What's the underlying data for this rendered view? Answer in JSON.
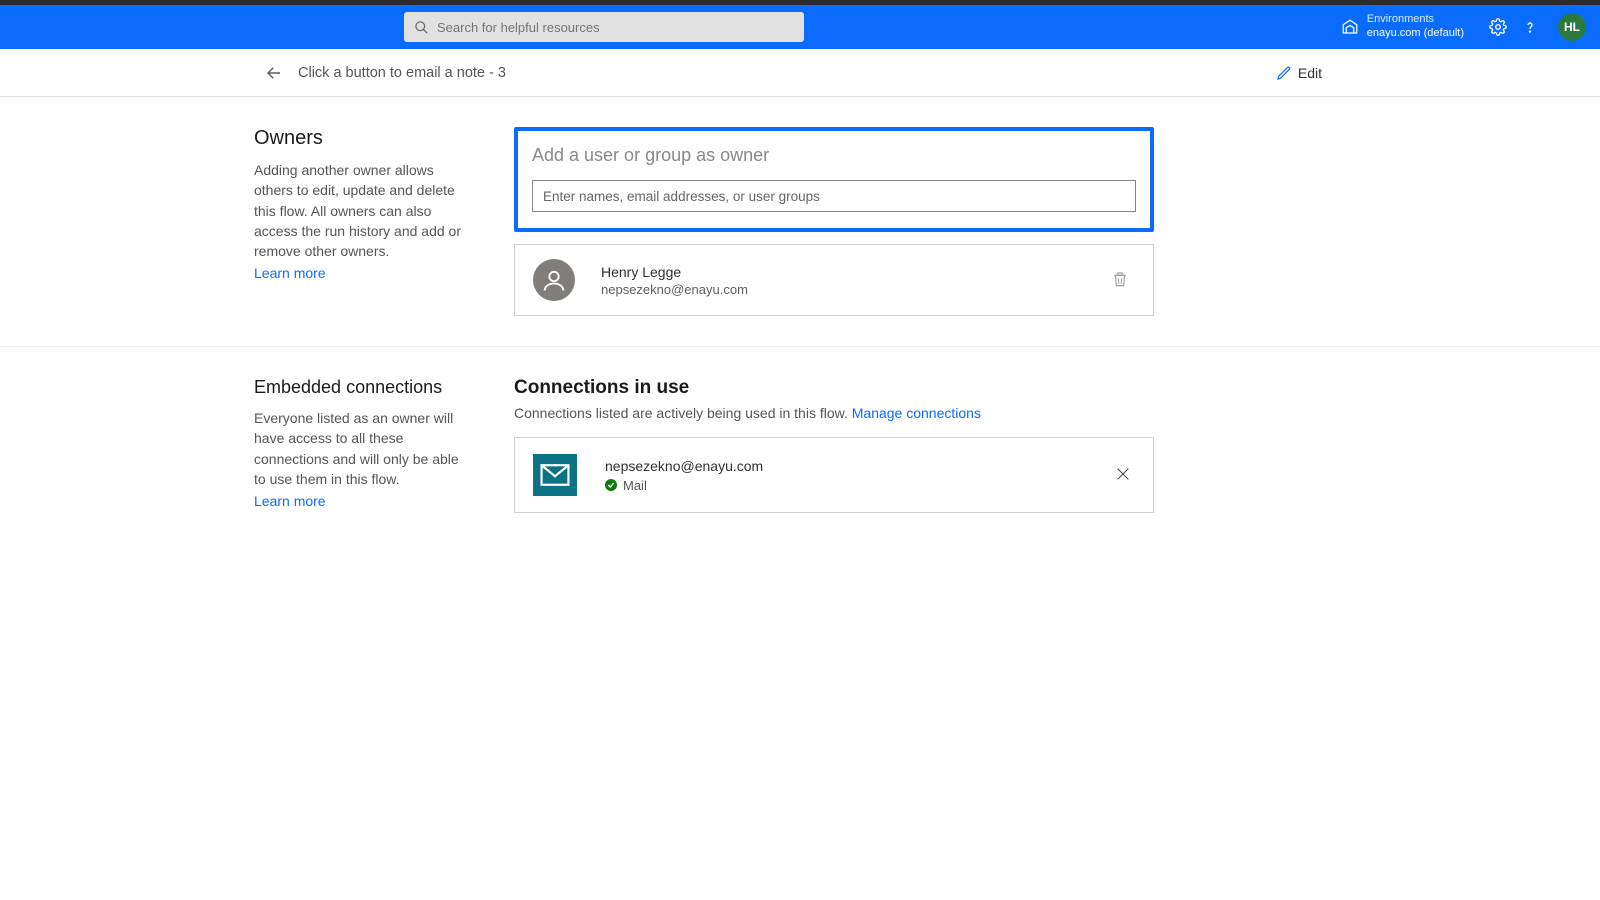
{
  "topbar": {
    "search_placeholder": "Search for helpful resources",
    "env_label": "Environments",
    "env_value": "enayu.com (default)",
    "avatar_initials": "HL"
  },
  "subbar": {
    "breadcrumb": "Click a button to email a note - 3",
    "edit_label": "Edit"
  },
  "owners": {
    "heading": "Owners",
    "description": "Adding another owner allows others to edit, update and delete this flow. All owners can also access the run history and add or remove other owners.",
    "learn_more": "Learn more",
    "add_title": "Add a user or group as owner",
    "add_placeholder": "Enter names, email addresses, or user groups",
    "owner_name": "Henry Legge",
    "owner_email": "nepsezekno@enayu.com"
  },
  "connections": {
    "left_heading": "Embedded connections",
    "left_description": "Everyone listed as an owner will have access to all these connections and will only be able to use them in this flow.",
    "learn_more": "Learn more",
    "right_heading": "Connections in use",
    "right_sub": "Connections listed are actively being used in this flow. ",
    "manage_link": "Manage connections",
    "conn_email": "nepsezekno@enayu.com",
    "conn_service": "Mail"
  }
}
